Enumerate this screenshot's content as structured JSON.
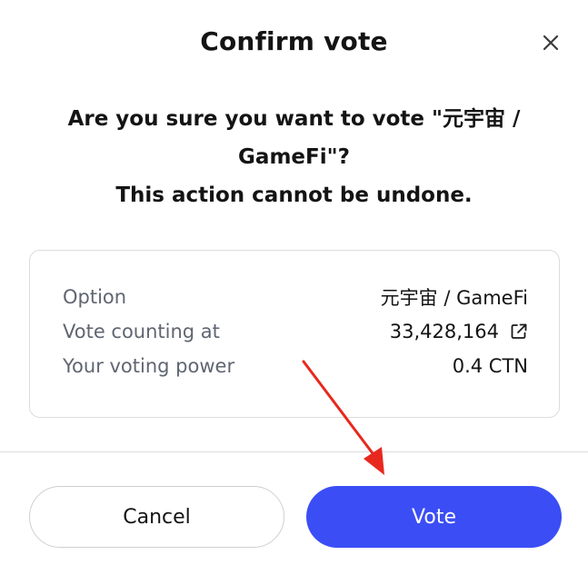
{
  "dialog": {
    "title": "Confirm vote",
    "close_icon": "close-icon",
    "question_line1": "Are you sure you want to vote \"元宇宙 /",
    "question_line2": "GameFi\"?",
    "warning": "This action cannot be undone."
  },
  "details": {
    "option_label": "Option",
    "option_value": "元宇宙 / GameFi",
    "counting_label": "Vote counting at",
    "counting_value": "33,428,164",
    "counting_icon": "external-link-icon",
    "power_label": "Your voting power",
    "power_value": "0.4 CTN"
  },
  "actions": {
    "cancel_label": "Cancel",
    "vote_label": "Vote"
  },
  "colors": {
    "primary": "#3b4ef5",
    "annotation_arrow": "#e8281e",
    "muted_text": "#5f6672",
    "border": "#dcdcdc"
  }
}
